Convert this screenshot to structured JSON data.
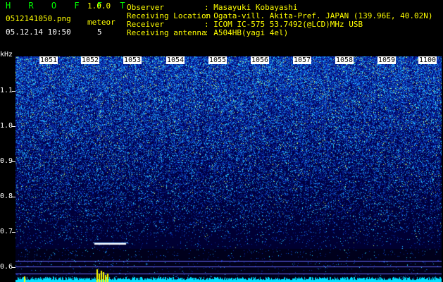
{
  "header": {
    "app_name": "H R O F F T",
    "version": "1.0.0",
    "filename": "0512141050.png",
    "datetime": "05.12.14 10:50",
    "meteor_label": "meteor",
    "meteor_count": "5"
  },
  "info": {
    "labels": [
      "Observer",
      "Receiving Location",
      "Receiver",
      "Receiving antenna"
    ],
    "values": [
      ": Masayuki Kobayashi",
      ": Ogata-vill. Akita-Pref. JAPAN (139.96E, 40.02N)",
      ": ICOM IC-575 53.7492(@LCD)MHz USB",
      ": A504HB(yagi 4el)"
    ]
  },
  "plot": {
    "y_unit": "kHz",
    "y_labels": [
      "1.1",
      "1.0",
      "0.9",
      "0.8",
      "0.7",
      "0.6"
    ],
    "time_labels": [
      "1051",
      "1052",
      "1053",
      "1054",
      "1055",
      "1056",
      "1057",
      "1058",
      "1059",
      "1100"
    ]
  },
  "colors": {
    "text_green": "#00ff00",
    "text_yellow": "#ffff00",
    "background": "#000000"
  }
}
